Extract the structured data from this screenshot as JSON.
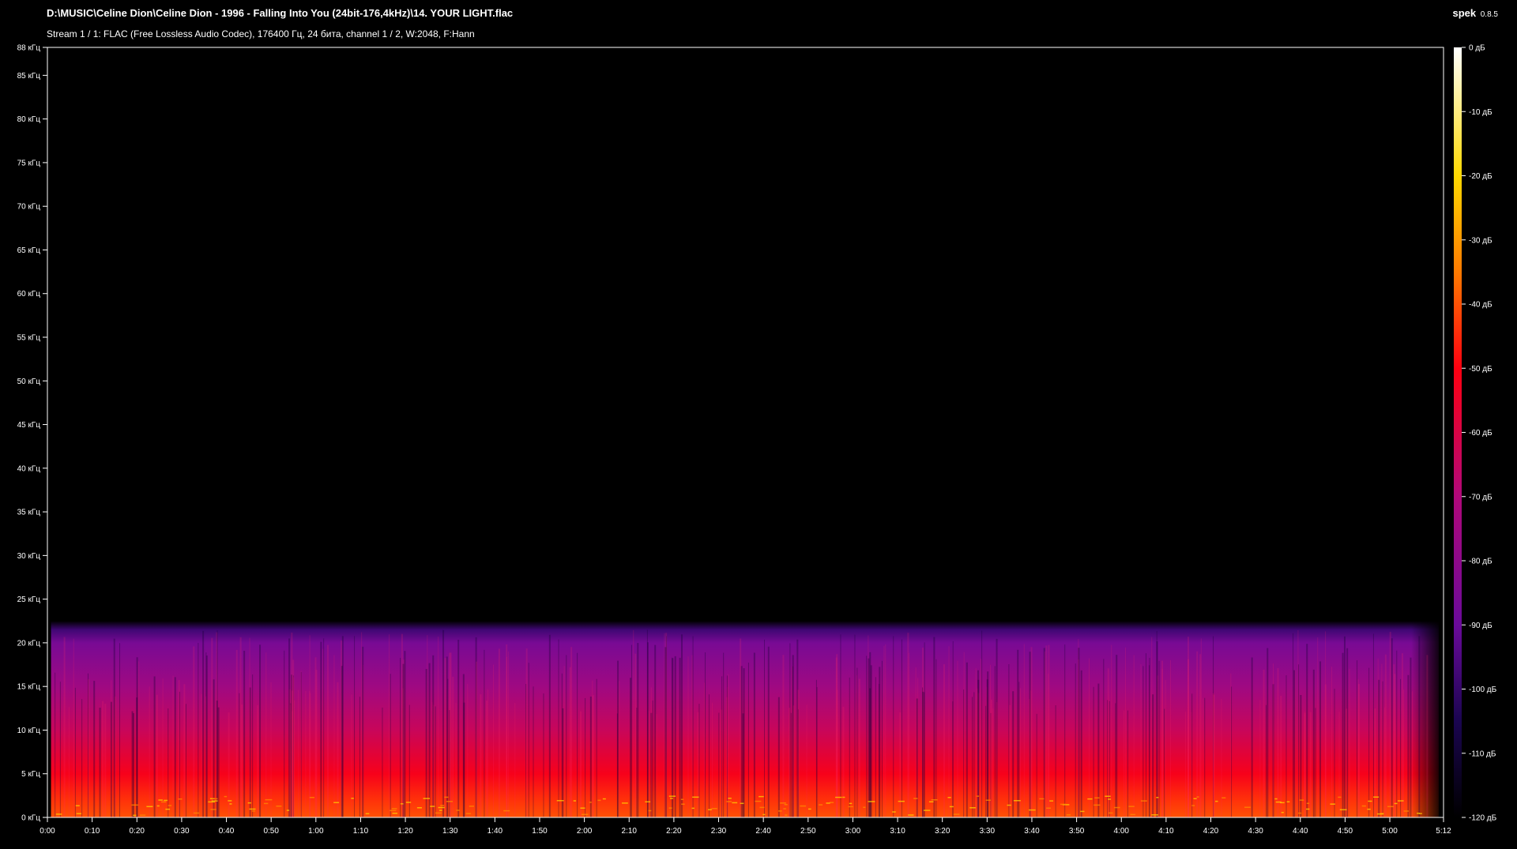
{
  "header": {
    "title": "D:\\MUSIC\\Celine Dion\\Celine Dion - 1996 - Falling Into You (24bit-176,4kHz)\\14. YOUR LIGHT.flac",
    "subtitle": "Stream 1 / 1: FLAC (Free Lossless Audio Codec), 176400 Гц, 24 бита, channel 1 / 2, W:2048, F:Hann",
    "app_name": "spek",
    "app_version": "0.8.5"
  },
  "chart_data": {
    "type": "heatmap",
    "x_axis": {
      "range_seconds": [
        0,
        312
      ],
      "ticks": [
        {
          "t": 0,
          "label": "0:00"
        },
        {
          "t": 10,
          "label": "0:10"
        },
        {
          "t": 20,
          "label": "0:20"
        },
        {
          "t": 30,
          "label": "0:30"
        },
        {
          "t": 40,
          "label": "0:40"
        },
        {
          "t": 50,
          "label": "0:50"
        },
        {
          "t": 60,
          "label": "1:00"
        },
        {
          "t": 70,
          "label": "1:10"
        },
        {
          "t": 80,
          "label": "1:20"
        },
        {
          "t": 90,
          "label": "1:30"
        },
        {
          "t": 100,
          "label": "1:40"
        },
        {
          "t": 110,
          "label": "1:50"
        },
        {
          "t": 120,
          "label": "2:00"
        },
        {
          "t": 130,
          "label": "2:10"
        },
        {
          "t": 140,
          "label": "2:20"
        },
        {
          "t": 150,
          "label": "2:30"
        },
        {
          "t": 160,
          "label": "2:40"
        },
        {
          "t": 170,
          "label": "2:50"
        },
        {
          "t": 180,
          "label": "3:00"
        },
        {
          "t": 190,
          "label": "3:10"
        },
        {
          "t": 200,
          "label": "3:20"
        },
        {
          "t": 210,
          "label": "3:30"
        },
        {
          "t": 220,
          "label": "3:40"
        },
        {
          "t": 230,
          "label": "3:50"
        },
        {
          "t": 240,
          "label": "4:00"
        },
        {
          "t": 250,
          "label": "4:10"
        },
        {
          "t": 260,
          "label": "4:20"
        },
        {
          "t": 270,
          "label": "4:30"
        },
        {
          "t": 280,
          "label": "4:40"
        },
        {
          "t": 290,
          "label": "4:50"
        },
        {
          "t": 300,
          "label": "5:00"
        },
        {
          "t": 312,
          "label": "5:12"
        }
      ]
    },
    "y_axis": {
      "range_khz": [
        0,
        88.2
      ],
      "ticks": [
        {
          "f": 0,
          "label": "0 кГц"
        },
        {
          "f": 5,
          "label": "5 кГц"
        },
        {
          "f": 10,
          "label": "10 кГц"
        },
        {
          "f": 15,
          "label": "15 кГц"
        },
        {
          "f": 20,
          "label": "20 кГц"
        },
        {
          "f": 25,
          "label": "25 кГц"
        },
        {
          "f": 30,
          "label": "30 кГц"
        },
        {
          "f": 35,
          "label": "35 кГц"
        },
        {
          "f": 40,
          "label": "40 кГц"
        },
        {
          "f": 45,
          "label": "45 кГц"
        },
        {
          "f": 50,
          "label": "50 кГц"
        },
        {
          "f": 55,
          "label": "55 кГц"
        },
        {
          "f": 60,
          "label": "60 кГц"
        },
        {
          "f": 65,
          "label": "65 кГц"
        },
        {
          "f": 70,
          "label": "70 кГц"
        },
        {
          "f": 75,
          "label": "75 кГц"
        },
        {
          "f": 80,
          "label": "80 кГц"
        },
        {
          "f": 85,
          "label": "85 кГц"
        },
        {
          "f": 88.2,
          "label": "88 кГц"
        }
      ]
    },
    "color_scale": {
      "range_db": [
        -120,
        0
      ],
      "ticks": [
        {
          "db": 0,
          "label": "0 дБ"
        },
        {
          "db": -10,
          "label": "-10 дБ"
        },
        {
          "db": -20,
          "label": "-20 дБ"
        },
        {
          "db": -30,
          "label": "-30 дБ"
        },
        {
          "db": -40,
          "label": "-40 дБ"
        },
        {
          "db": -50,
          "label": "-50 дБ"
        },
        {
          "db": -60,
          "label": "-60 дБ"
        },
        {
          "db": -70,
          "label": "-70 дБ"
        },
        {
          "db": -80,
          "label": "-80 дБ"
        },
        {
          "db": -90,
          "label": "-90 дБ"
        },
        {
          "db": -100,
          "label": "-100 дБ"
        },
        {
          "db": -110,
          "label": "-110 дБ"
        },
        {
          "db": -120,
          "label": "-120 дБ"
        }
      ],
      "stops": [
        {
          "db": -120,
          "color": "#000000"
        },
        {
          "db": -105,
          "color": "#1a0550"
        },
        {
          "db": -90,
          "color": "#6a0a9a"
        },
        {
          "db": -70,
          "color": "#b0087a"
        },
        {
          "db": -50,
          "color": "#ff0010"
        },
        {
          "db": -35,
          "color": "#ff7a00"
        },
        {
          "db": -20,
          "color": "#ffd800"
        },
        {
          "db": 0,
          "color": "#ffffff"
        }
      ]
    },
    "content_cutoff_khz": 21.5,
    "energy_profile_db": [
      {
        "f": 0,
        "db": -40
      },
      {
        "f": 2,
        "db": -44
      },
      {
        "f": 5,
        "db": -52
      },
      {
        "f": 10,
        "db": -64
      },
      {
        "f": 15,
        "db": -75
      },
      {
        "f": 20,
        "db": -86
      },
      {
        "f": 21.5,
        "db": -98
      },
      {
        "f": 22.5,
        "db": -120
      }
    ]
  }
}
